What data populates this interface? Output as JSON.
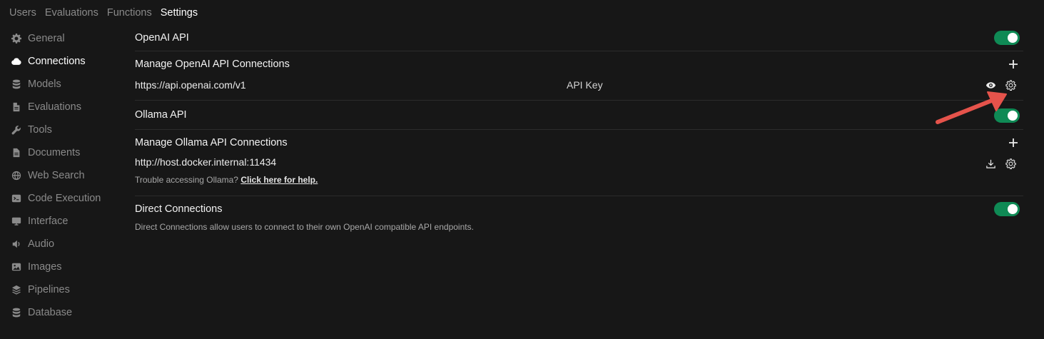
{
  "topnav": {
    "tabs": [
      {
        "label": "Users"
      },
      {
        "label": "Evaluations"
      },
      {
        "label": "Functions"
      },
      {
        "label": "Settings"
      }
    ]
  },
  "sidebar": {
    "items": [
      {
        "label": "General",
        "icon": "gear-icon"
      },
      {
        "label": "Connections",
        "icon": "cloud-icon"
      },
      {
        "label": "Models",
        "icon": "database-stack-icon"
      },
      {
        "label": "Evaluations",
        "icon": "document-icon"
      },
      {
        "label": "Tools",
        "icon": "wrench-icon"
      },
      {
        "label": "Documents",
        "icon": "document-icon"
      },
      {
        "label": "Web Search",
        "icon": "globe-icon"
      },
      {
        "label": "Code Execution",
        "icon": "terminal-icon"
      },
      {
        "label": "Interface",
        "icon": "monitor-icon"
      },
      {
        "label": "Audio",
        "icon": "speaker-icon"
      },
      {
        "label": "Images",
        "icon": "image-icon"
      },
      {
        "label": "Pipelines",
        "icon": "layers-icon"
      },
      {
        "label": "Database",
        "icon": "database-icon"
      }
    ]
  },
  "openai": {
    "title": "OpenAI API",
    "manage_title": "Manage OpenAI API Connections",
    "url": "https://api.openai.com/v1",
    "key_label": "API Key"
  },
  "ollama": {
    "title": "Ollama API",
    "manage_title": "Manage Ollama API Connections",
    "url": "http://host.docker.internal:11434",
    "help_text": "Trouble accessing Ollama?",
    "help_link": "Click here for help."
  },
  "direct": {
    "title": "Direct Connections",
    "description": "Direct Connections allow users to connect to their own OpenAI compatible API endpoints."
  },
  "colors": {
    "background": "#171717",
    "toggle_on": "#0f8a55",
    "annotation_arrow": "#e5534b"
  }
}
